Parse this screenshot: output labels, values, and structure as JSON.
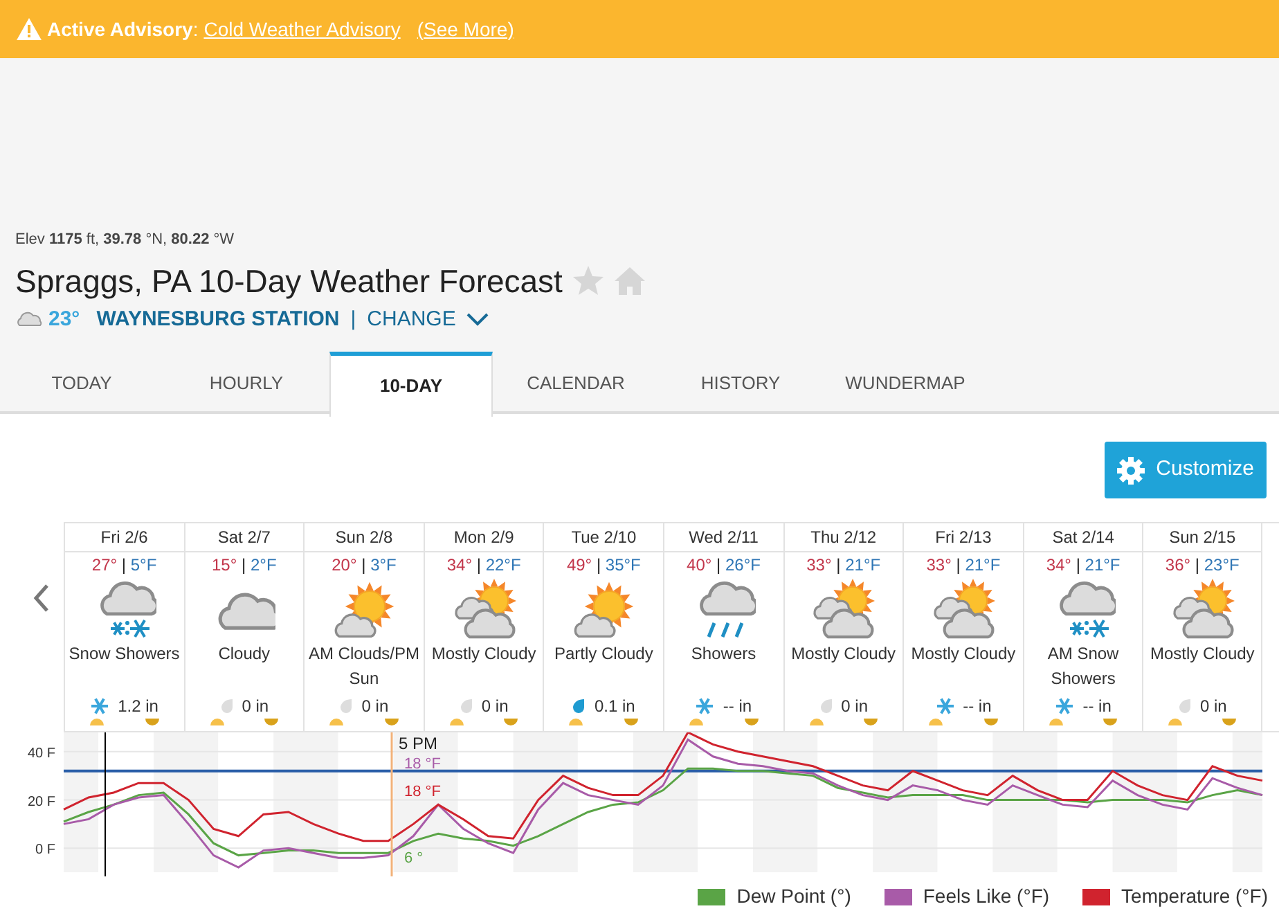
{
  "advisory": {
    "label": "**Active Advisory**:",
    "link": "Cold Weather Advisory",
    "more": "(See More)"
  },
  "location": {
    "elevation": "Elev **1175** ft, **39.78** °N, **80.22** °W",
    "title": "Spraggs, PA 10-Day Weather Forecast",
    "favorite": false,
    "current_temp": "23°",
    "station": "WAYNESBURG STATION",
    "separator": "|",
    "change": "CHANGE"
  },
  "tabs": [
    {
      "label": "TODAY",
      "selected": false
    },
    {
      "label": "HOURLY",
      "selected": false
    },
    {
      "label": "10-DAY",
      "selected": true
    },
    {
      "label": "CALENDAR",
      "selected": false
    },
    {
      "label": "HISTORY",
      "selected": false
    },
    {
      "label": "WUNDERMAP",
      "selected": false
    }
  ],
  "customize": "Customize",
  "days": [
    {
      "date": "Fri 2/6",
      "high": "27°",
      "separator": "|",
      "low": "5°F",
      "kind": "snow-showers",
      "condition": "Snow Showers",
      "precip": {
        "kind": "snow",
        "amount": "1.2 in"
      }
    },
    {
      "date": "Sat 2/7",
      "high": "15°",
      "separator": "|",
      "low": "2°F",
      "kind": "cloudy",
      "condition": "Cloudy",
      "precip": {
        "kind": "none",
        "amount": "0 in"
      }
    },
    {
      "date": "Sun 2/8",
      "high": "20°",
      "separator": "|",
      "low": "3°F",
      "kind": "partly-cloudy",
      "condition": "AM Clouds/PM Sun",
      "precip": {
        "kind": "none",
        "amount": "0 in"
      }
    },
    {
      "date": "Mon 2/9",
      "high": "34°",
      "separator": "|",
      "low": "22°F",
      "kind": "mostly-cloudy",
      "condition": "Mostly Cloudy",
      "precip": {
        "kind": "none",
        "amount": "0 in"
      }
    },
    {
      "date": "Tue 2/10",
      "high": "49°",
      "separator": "|",
      "low": "35°F",
      "kind": "partly-cloudy",
      "condition": "Partly Cloudy",
      "precip": {
        "kind": "rain",
        "amount": "0.1 in"
      }
    },
    {
      "date": "Wed 2/11",
      "high": "40°",
      "separator": "|",
      "low": "26°F",
      "kind": "showers",
      "condition": "Showers",
      "precip": {
        "kind": "snow",
        "amount": "-- in"
      }
    },
    {
      "date": "Thu 2/12",
      "high": "33°",
      "separator": "|",
      "low": "21°F",
      "kind": "mostly-cloudy",
      "condition": "Mostly Cloudy",
      "precip": {
        "kind": "none",
        "amount": "0 in"
      }
    },
    {
      "date": "Fri 2/13",
      "high": "33°",
      "separator": "|",
      "low": "21°F",
      "kind": "mostly-cloudy",
      "condition": "Mostly Cloudy",
      "precip": {
        "kind": "snow",
        "amount": "-- in"
      }
    },
    {
      "date": "Sat 2/14",
      "high": "34°",
      "separator": "|",
      "low": "21°F",
      "kind": "snow-showers",
      "condition": "AM Snow Showers",
      "precip": {
        "kind": "snow",
        "amount": "-- in"
      }
    },
    {
      "date": "Sun 2/15",
      "high": "36°",
      "separator": "|",
      "low": "23°F",
      "kind": "mostly-cloudy",
      "condition": "Mostly Cloudy",
      "precip": {
        "kind": "none",
        "amount": "0 in"
      }
    }
  ],
  "chart": {
    "chart_data": {
      "type": "line",
      "grid": true,
      "ylim": [
        -10,
        48
      ],
      "ref_lines": [
        {
          "axis": "y",
          "value": 32,
          "color": "#2a5ea8"
        }
      ],
      "yticks": [
        {
          "value": 40,
          "label": "40 F"
        },
        {
          "value": 20,
          "label": "20 F"
        },
        {
          "value": 0,
          "label": "0 F"
        }
      ],
      "series": [
        {
          "name": "Dew Point (°)",
          "color": "#5aa446",
          "values": [
            11,
            15,
            18,
            22,
            23,
            14,
            2,
            -3,
            -2,
            -1,
            -1,
            -2,
            -2,
            -2,
            3,
            6,
            4,
            3,
            1,
            5,
            10,
            15,
            18,
            19,
            24,
            33,
            33,
            32,
            32,
            31,
            30,
            25,
            23,
            21,
            22,
            22,
            22,
            20,
            20,
            20,
            20,
            19,
            20,
            20,
            20,
            19,
            22,
            24,
            22
          ]
        },
        {
          "name": "Feels Like (°F)",
          "color": "#a85ba8",
          "values": [
            10,
            12,
            18,
            21,
            22,
            10,
            -3,
            -8,
            -1,
            0,
            -2,
            -4,
            -4,
            -3,
            5,
            18,
            8,
            2,
            -2,
            16,
            27,
            22,
            20,
            18,
            26,
            45,
            38,
            35,
            34,
            32,
            31,
            26,
            22,
            20,
            26,
            24,
            20,
            18,
            26,
            22,
            18,
            17,
            28,
            22,
            18,
            16,
            29,
            25,
            22
          ]
        },
        {
          "name": "Temperature (°F)",
          "color": "#d0232e",
          "values": [
            16,
            21,
            23,
            27,
            27,
            20,
            8,
            5,
            14,
            15,
            10,
            6,
            3,
            3,
            10,
            18,
            12,
            5,
            4,
            20,
            30,
            25,
            22,
            22,
            30,
            48,
            43,
            40,
            38,
            36,
            34,
            30,
            26,
            24,
            32,
            28,
            24,
            22,
            30,
            24,
            20,
            20,
            32,
            26,
            22,
            20,
            34,
            30,
            28
          ]
        }
      ]
    },
    "hover": {
      "time": "5 PM",
      "readings": [
        {
          "color": "#a85ba8",
          "text": "18 °F"
        },
        {
          "color": "#d0232e",
          "text": "18 °F"
        },
        {
          "color": "#5aa446",
          "text": "6 °"
        }
      ]
    }
  }
}
